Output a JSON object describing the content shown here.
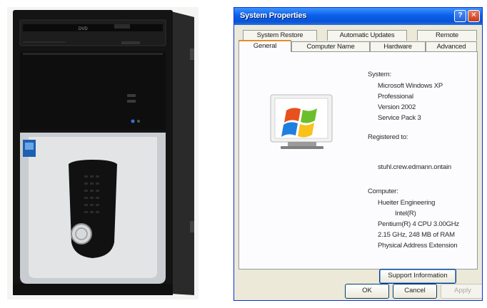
{
  "window": {
    "title": "System Properties",
    "help_glyph": "?",
    "close_glyph": "✕"
  },
  "tabs_back": [
    {
      "label": "System Restore"
    },
    {
      "label": "Automatic Updates"
    },
    {
      "label": "Remote"
    }
  ],
  "tabs_front": [
    {
      "label": "General",
      "active": true
    },
    {
      "label": "Computer Name",
      "active": false
    },
    {
      "label": "Hardware",
      "active": false
    },
    {
      "label": "Advanced",
      "active": false
    }
  ],
  "general": {
    "system_heading": "System:",
    "system_lines": [
      "Microsoft Windows XP",
      "Professional",
      "Version 2002",
      "Service Pack 3"
    ],
    "registered_heading": "Registered to:",
    "registered_value": "stuhl.crew.edmann.ontain",
    "computer_heading": "Computer:",
    "computer_lines": [
      "Hueiter Engineering",
      "Intel(R)",
      "Pentium(R) 4 CPU 3.00GHz",
      "2.15 GHz, 248 MB of RAM",
      "Physical Address Extension"
    ],
    "support_button": "Support Information"
  },
  "footer": {
    "ok": "OK",
    "cancel": "Cancel",
    "apply": "Apply"
  },
  "colors": {
    "titlebar": "#0a5fe9",
    "dialog_bg": "#ece9d8",
    "active_tab_accent": "#e68b2c",
    "pc_case": "#121212",
    "pc_bezel": "#d8dadc",
    "pc_power_led": "#3a6fd8"
  },
  "pc_photo": {
    "drive_logo": "DVD",
    "icons": [
      "windows-logo-sticker",
      "power-button",
      "usb-ports",
      "card-reader"
    ]
  }
}
